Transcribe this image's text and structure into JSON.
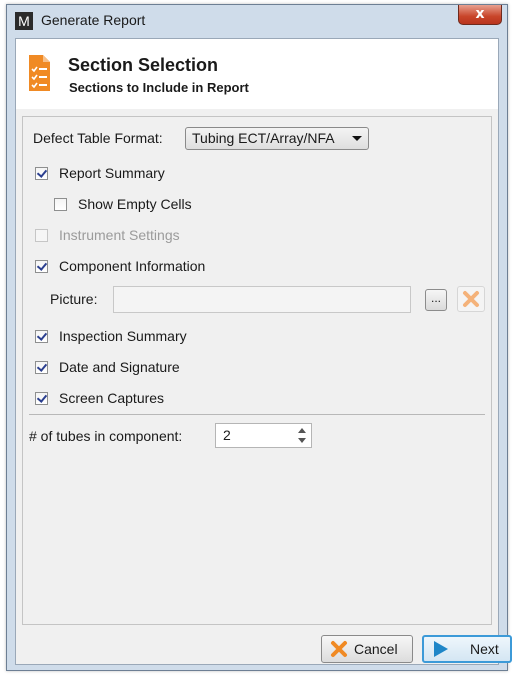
{
  "window": {
    "title": "Generate Report",
    "app_icon_letter": "M",
    "close_label": "x"
  },
  "header": {
    "title": "Section Selection",
    "subtitle": "Sections to Include in Report",
    "icon": "report-list-icon"
  },
  "defect_table": {
    "label": "Defect Table Format:",
    "selected": "Tubing ECT/Array/NFA"
  },
  "options": {
    "report_summary": {
      "label": "Report Summary",
      "checked": true
    },
    "show_empty_cells": {
      "label": "Show Empty Cells",
      "checked": false
    },
    "instrument_settings": {
      "label": "Instrument Settings",
      "checked": false,
      "disabled": true
    },
    "component_information": {
      "label": "Component Information",
      "checked": true
    },
    "inspection_summary": {
      "label": "Inspection Summary",
      "checked": true
    },
    "date_signature": {
      "label": "Date and Signature",
      "checked": true
    },
    "screen_captures": {
      "label": "Screen Captures",
      "checked": true
    }
  },
  "picture": {
    "label": "Picture:",
    "value": "",
    "browse_label": "..."
  },
  "tubes": {
    "label": "# of tubes in component:",
    "value": "2"
  },
  "buttons": {
    "cancel": "Cancel",
    "next": "Next"
  },
  "colors": {
    "accent_orange": "#f08a24",
    "next_blue": "#1e86c8",
    "title_bar": "#cfdcea"
  }
}
